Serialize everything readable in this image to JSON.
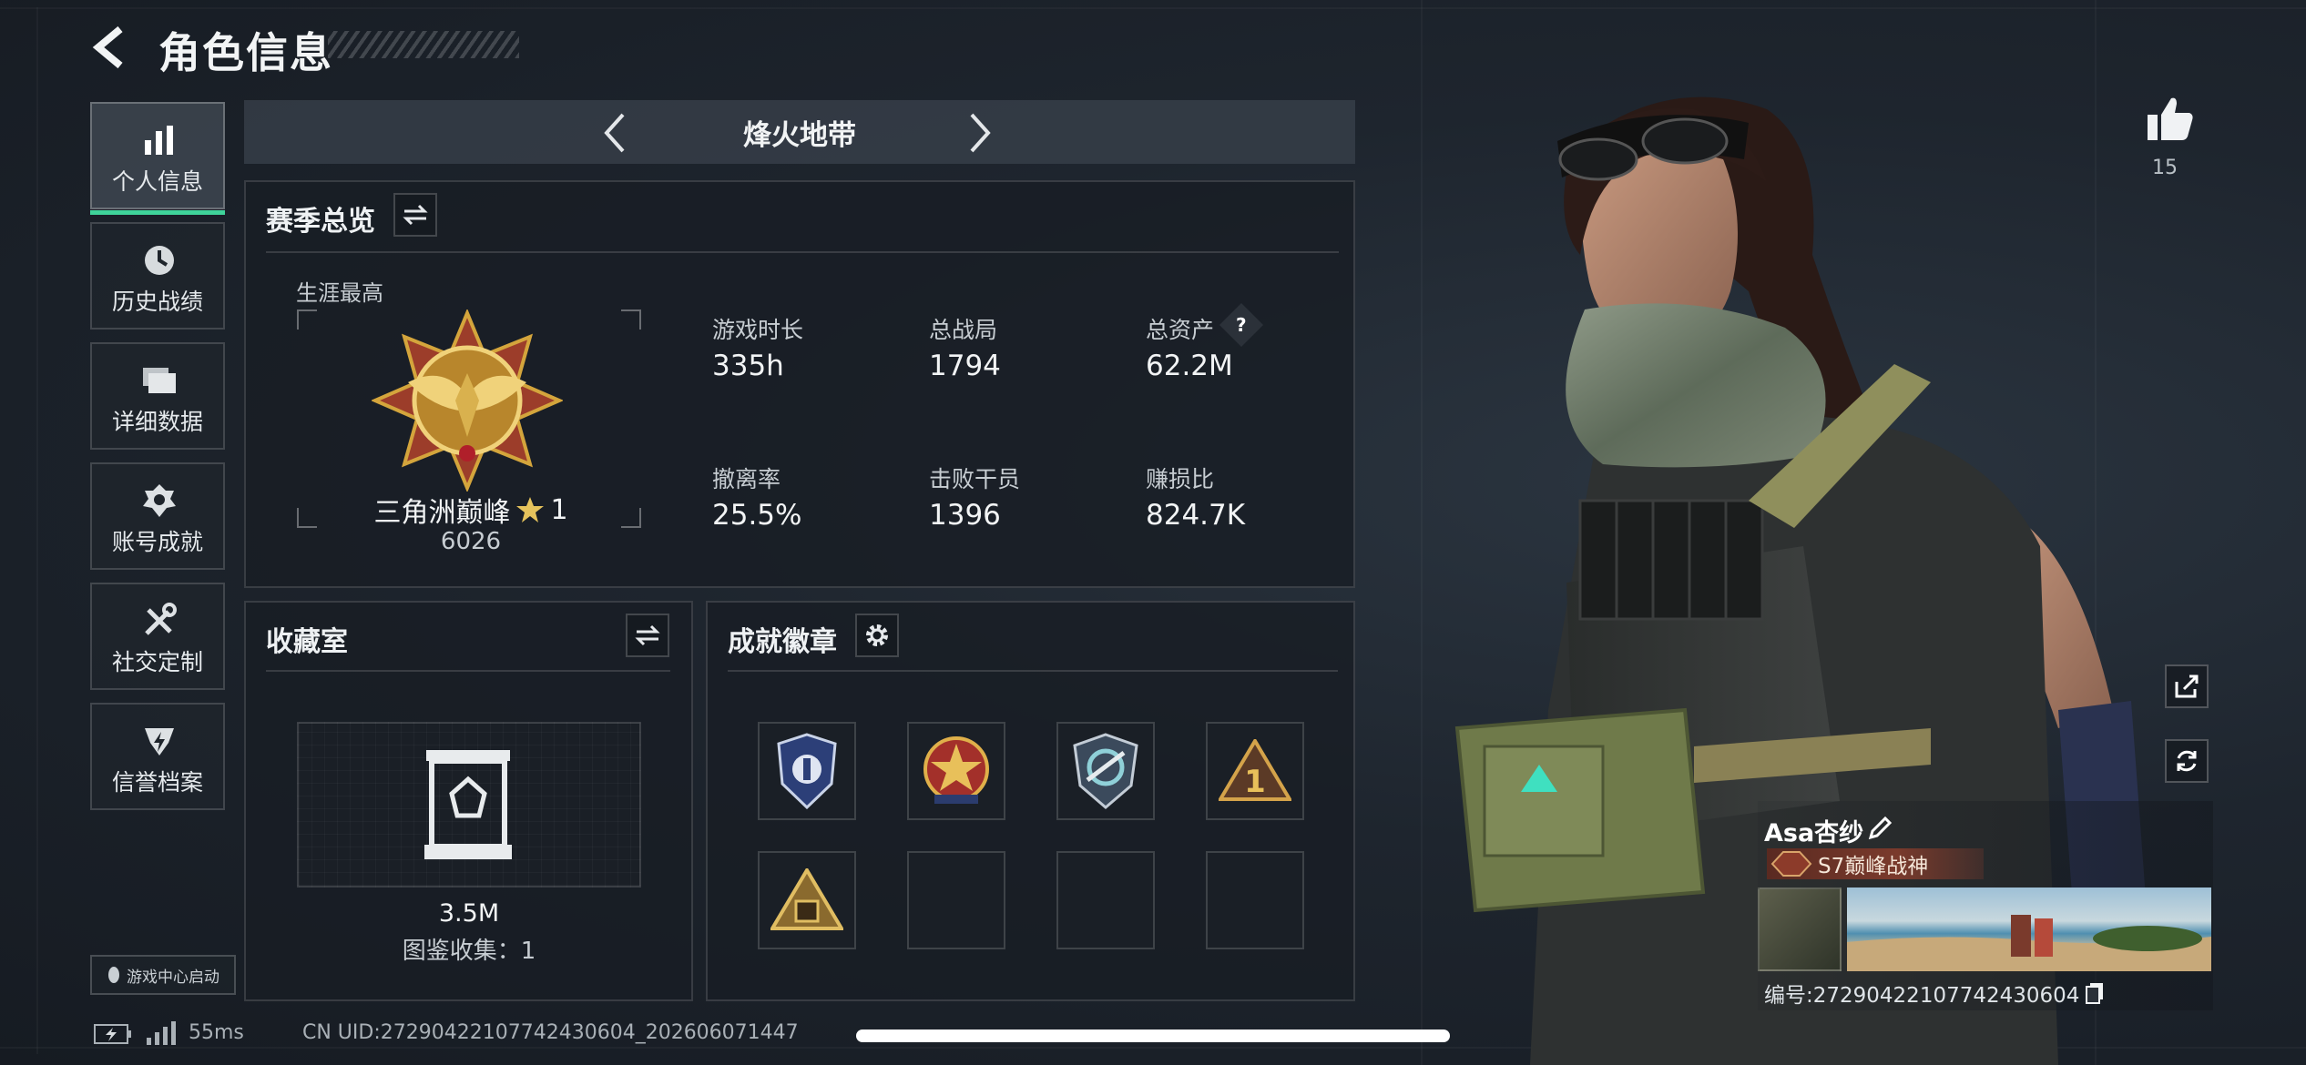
{
  "header": {
    "title": "角色信息"
  },
  "sidebar": {
    "items": [
      {
        "label": "个人信息",
        "icon": "bar-chart-icon",
        "active": true
      },
      {
        "label": "历史战绩",
        "icon": "clock-icon",
        "active": false
      },
      {
        "label": "详细数据",
        "icon": "folder-icon",
        "active": false
      },
      {
        "label": "账号成就",
        "icon": "achievement-icon",
        "active": false
      },
      {
        "label": "社交定制",
        "icon": "tools-icon",
        "active": false
      },
      {
        "label": "信誉档案",
        "icon": "shield-icon",
        "active": false
      }
    ],
    "game_center": "游戏中心启动"
  },
  "mode": {
    "title": "烽火地带"
  },
  "season": {
    "title": "赛季总览",
    "career_label": "生涯最高",
    "rank_name": "三角洲巅峰",
    "rank_stars": "1",
    "rank_score": "6026",
    "stats": [
      {
        "label": "游戏时长",
        "value": "335h"
      },
      {
        "label": "总战局",
        "value": "1794"
      },
      {
        "label": "总资产",
        "value": "62.2M",
        "help": "?"
      },
      {
        "label": "撤离率",
        "value": "25.5%"
      },
      {
        "label": "击败干员",
        "value": "1396"
      },
      {
        "label": "赚损比",
        "value": "824.7K"
      }
    ]
  },
  "collection": {
    "title": "收藏室",
    "value": "3.5M",
    "catalog": "图鉴收集：1"
  },
  "badges": {
    "title": "成就徽章",
    "slots": [
      {
        "icon": "shield-badge-icon",
        "filled": true
      },
      {
        "icon": "star-medal-icon",
        "filled": true
      },
      {
        "icon": "crest-badge-icon",
        "filled": true
      },
      {
        "icon": "triangle-one-badge-icon",
        "filled": true
      },
      {
        "icon": "pyramid-badge-icon",
        "filled": true
      },
      {
        "icon": "",
        "filled": false
      },
      {
        "icon": "",
        "filled": false
      },
      {
        "icon": "",
        "filled": false
      }
    ]
  },
  "likes": {
    "count": "15"
  },
  "profile": {
    "name": "Asa杏纱",
    "title_badge": "S7巅峰战神",
    "id_text": "编号:2729042210774243060​4"
  },
  "footer": {
    "latency": "55ms",
    "uid": "CN UID:2729042210774243060​4_202606071447"
  },
  "colors": {
    "accent": "#3fd39a",
    "background": "#1d232c",
    "rank_gold": "#d4a53c"
  }
}
